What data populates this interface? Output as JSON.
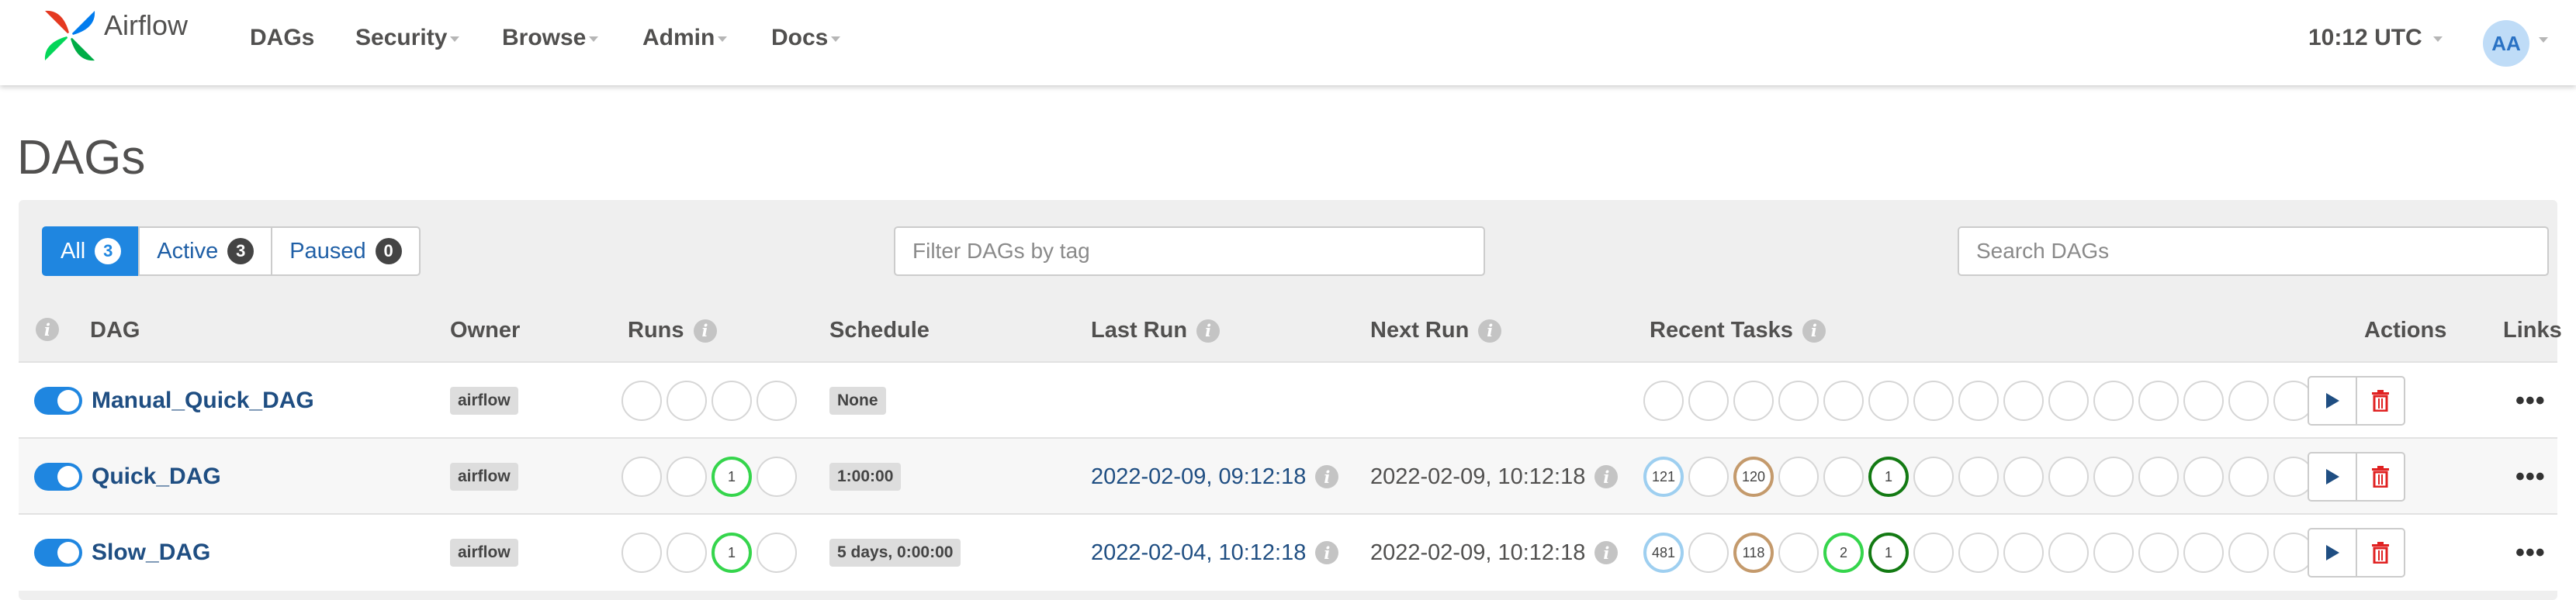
{
  "navbar": {
    "brand": "Airflow",
    "items": [
      {
        "label": "DAGs",
        "dropdown": false
      },
      {
        "label": "Security",
        "dropdown": true
      },
      {
        "label": "Browse",
        "dropdown": true
      },
      {
        "label": "Admin",
        "dropdown": true
      },
      {
        "label": "Docs",
        "dropdown": true
      }
    ],
    "clock": "10:12 UTC",
    "user_initials": "AA"
  },
  "page_title": "DAGs",
  "filters": {
    "all_label": "All",
    "all_count": "3",
    "active_label": "Active",
    "active_count": "3",
    "paused_label": "Paused",
    "paused_count": "0",
    "tag_placeholder": "Filter DAGs by tag",
    "search_placeholder": "Search DAGs"
  },
  "table": {
    "headers": {
      "dag": "DAG",
      "owner": "Owner",
      "runs": "Runs",
      "schedule": "Schedule",
      "last_run": "Last Run",
      "next_run": "Next Run",
      "recent_tasks": "Recent Tasks",
      "actions": "Actions",
      "links": "Links"
    },
    "info_glyph": "i",
    "links_glyph": "•••",
    "rows": [
      {
        "dag": "Manual_Quick_DAG",
        "owner": "airflow",
        "schedule": "None",
        "last_run": "",
        "next_run": "",
        "runs": [
          {
            "v": "",
            "s": "none"
          },
          {
            "v": "",
            "s": "none"
          },
          {
            "v": "",
            "s": "none"
          },
          {
            "v": "",
            "s": "none"
          }
        ],
        "tasks": [
          {
            "v": "",
            "s": "none"
          },
          {
            "v": "",
            "s": "none"
          },
          {
            "v": "",
            "s": "none"
          },
          {
            "v": "",
            "s": "none"
          },
          {
            "v": "",
            "s": "none"
          },
          {
            "v": "",
            "s": "none"
          },
          {
            "v": "",
            "s": "none"
          },
          {
            "v": "",
            "s": "none"
          },
          {
            "v": "",
            "s": "none"
          },
          {
            "v": "",
            "s": "none"
          },
          {
            "v": "",
            "s": "none"
          },
          {
            "v": "",
            "s": "none"
          },
          {
            "v": "",
            "s": "none"
          },
          {
            "v": "",
            "s": "none"
          },
          {
            "v": "",
            "s": "none"
          }
        ]
      },
      {
        "dag": "Quick_DAG",
        "owner": "airflow",
        "schedule": "1:00:00",
        "last_run": "2022-02-09, 09:12:18",
        "next_run": "2022-02-09, 10:12:18",
        "runs": [
          {
            "v": "",
            "s": "none"
          },
          {
            "v": "",
            "s": "none"
          },
          {
            "v": "1",
            "s": "green"
          },
          {
            "v": "",
            "s": "none"
          }
        ],
        "tasks": [
          {
            "v": "121",
            "s": "lightblue"
          },
          {
            "v": "",
            "s": "none"
          },
          {
            "v": "120",
            "s": "tan"
          },
          {
            "v": "",
            "s": "none"
          },
          {
            "v": "",
            "s": "none"
          },
          {
            "v": "1",
            "s": "darkgreen"
          },
          {
            "v": "",
            "s": "none"
          },
          {
            "v": "",
            "s": "none"
          },
          {
            "v": "",
            "s": "none"
          },
          {
            "v": "",
            "s": "none"
          },
          {
            "v": "",
            "s": "none"
          },
          {
            "v": "",
            "s": "none"
          },
          {
            "v": "",
            "s": "none"
          },
          {
            "v": "",
            "s": "none"
          },
          {
            "v": "",
            "s": "none"
          }
        ]
      },
      {
        "dag": "Slow_DAG",
        "owner": "airflow",
        "schedule": "5 days, 0:00:00",
        "last_run": "2022-02-04, 10:12:18",
        "next_run": "2022-02-09, 10:12:18",
        "runs": [
          {
            "v": "",
            "s": "none"
          },
          {
            "v": "",
            "s": "none"
          },
          {
            "v": "1",
            "s": "green"
          },
          {
            "v": "",
            "s": "none"
          }
        ],
        "tasks": [
          {
            "v": "481",
            "s": "lightblue"
          },
          {
            "v": "",
            "s": "none"
          },
          {
            "v": "118",
            "s": "tan"
          },
          {
            "v": "",
            "s": "none"
          },
          {
            "v": "2",
            "s": "green"
          },
          {
            "v": "1",
            "s": "darkgreen"
          },
          {
            "v": "",
            "s": "none"
          },
          {
            "v": "",
            "s": "none"
          },
          {
            "v": "",
            "s": "none"
          },
          {
            "v": "",
            "s": "none"
          },
          {
            "v": "",
            "s": "none"
          },
          {
            "v": "",
            "s": "none"
          },
          {
            "v": "",
            "s": "none"
          },
          {
            "v": "",
            "s": "none"
          },
          {
            "v": "",
            "s": "none"
          }
        ]
      }
    ]
  },
  "colors": {
    "accent": "#1f86e0",
    "link": "#1f4e82",
    "success": "#35d54c",
    "success_dark": "#137a13",
    "upstream_failed": "#c49a6c",
    "scheduled": "#9ecff0",
    "delete": "#e02222"
  }
}
